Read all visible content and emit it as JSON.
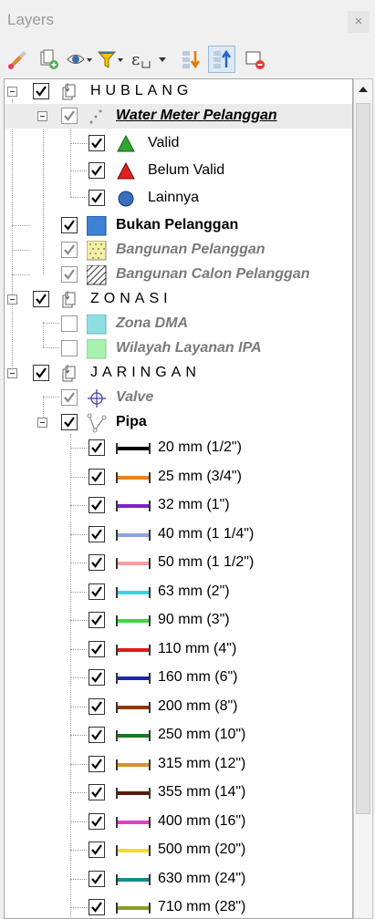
{
  "panel": {
    "title": "Layers",
    "close_label": "×",
    "toolbar": [
      {
        "name": "style-manager-icon"
      },
      {
        "name": "add-group-icon"
      },
      {
        "name": "visibility-eye-icon"
      },
      {
        "name": "filter-icon"
      },
      {
        "name": "filter-expression-icon"
      },
      {
        "name": "expand-all-icon"
      },
      {
        "name": "collapse-all-icon"
      },
      {
        "name": "remove-layer-icon"
      }
    ]
  },
  "tree": {
    "groups": {
      "hublang": "HUBLANG",
      "zonasi": "ZONASI",
      "jaringan": "JARINGAN"
    },
    "layers": {
      "water_meter": "Water Meter Pelanggan",
      "valid": "Valid",
      "belum_valid": "Belum Valid",
      "lainnya": "Lainnya",
      "bukan_pelanggan": "Bukan Pelanggan",
      "bangunan_pelanggan": "Bangunan Pelanggan",
      "bangunan_calon": "Bangunan Calon Pelanggan",
      "zona_dma": "Zona DMA",
      "wilayah_layanan": "Wilayah Layanan IPA",
      "valve": "Valve",
      "pipa": "Pipa"
    },
    "pipes": [
      {
        "label": "20 mm (1/2\")",
        "color": "#000000"
      },
      {
        "label": "25 mm (3/4\")",
        "color": "#f07f1c"
      },
      {
        "label": "32 mm (1\")",
        "color": "#7a22c4"
      },
      {
        "label": "40 mm (1 1/4\")",
        "color": "#8aa4e6"
      },
      {
        "label": "50 mm (1 1/2\")",
        "color": "#f4a0a0"
      },
      {
        "label": "63 mm (2\")",
        "color": "#38d6e0"
      },
      {
        "label": "90 mm (3\")",
        "color": "#3ed63e"
      },
      {
        "label": "110 mm (4\")",
        "color": "#e01818"
      },
      {
        "label": "160 mm (6\")",
        "color": "#1a2aa8"
      },
      {
        "label": "200 mm (8\")",
        "color": "#8a3a10"
      },
      {
        "label": "250 mm (10\")",
        "color": "#1a7a1a"
      },
      {
        "label": "315 mm (12\")",
        "color": "#d6902e"
      },
      {
        "label": "355 mm (14\")",
        "color": "#5a1a08"
      },
      {
        "label": "400 mm (16\")",
        "color": "#e040c0"
      },
      {
        "label": "500 mm (20\")",
        "color": "#f0e020"
      },
      {
        "label": "630 mm (24\")",
        "color": "#168a8a"
      },
      {
        "label": "710 mm (28\")",
        "color": "#8a9a2a"
      }
    ]
  }
}
